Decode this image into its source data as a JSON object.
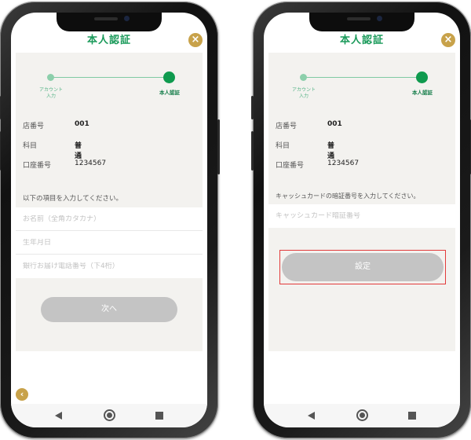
{
  "left": {
    "header_title": "本人認証",
    "close_icon": "×",
    "stepper": {
      "step1_label": "アカウント\n入力",
      "step2_label": "本人認証"
    },
    "info": [
      {
        "label": "店番号",
        "value": "001"
      },
      {
        "label": "科目",
        "value": "普通"
      },
      {
        "label": "口座番号",
        "value": "1234567"
      }
    ],
    "instruction": "以下の項目を入力してください。",
    "fields": {
      "name_placeholder": "お名前（全角カタカナ）",
      "birth_placeholder": "生年月日",
      "phone_placeholder": "銀行お届け電話番号（下4桁）"
    },
    "next_button": "次へ",
    "back_icon": "‹"
  },
  "right": {
    "header_title": "本人認証",
    "close_icon": "×",
    "stepper": {
      "step1_label": "アカウント\n入力",
      "step2_label": "本人認証"
    },
    "info": [
      {
        "label": "店番号",
        "value": "001"
      },
      {
        "label": "科目",
        "value": "普通"
      },
      {
        "label": "口座番号",
        "value": "1234567"
      }
    ],
    "instruction": "キャッシュカードの暗証番号を入力してください。",
    "fields": {
      "pin_placeholder": "キャッシュカード暗証番号"
    },
    "set_button": "設定"
  },
  "colors": {
    "accent_green": "#1a9a5a",
    "gold": "#c8a24a",
    "button_gray": "#c4c4c4",
    "highlight_red": "#e23a3a"
  }
}
